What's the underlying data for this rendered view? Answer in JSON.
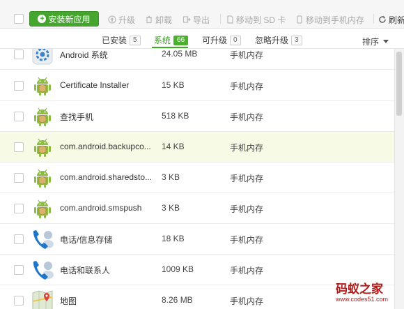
{
  "toolbar": {
    "install_label": "安装新应用",
    "items": [
      {
        "label": "升级",
        "icon": "upgrade-icon"
      },
      {
        "label": "卸载",
        "icon": "trash-icon"
      },
      {
        "label": "导出",
        "icon": "export-icon"
      },
      {
        "label": "移动到 SD 卡",
        "icon": "sd-card-icon"
      },
      {
        "label": "移动到手机内存",
        "icon": "phone-memory-icon"
      },
      {
        "label": "刷新",
        "icon": "refresh-icon"
      }
    ]
  },
  "tabs": [
    {
      "label": "已安装",
      "count": "5",
      "active": false
    },
    {
      "label": "系统",
      "count": "66",
      "active": true
    },
    {
      "label": "可升级",
      "count": "0",
      "active": false
    },
    {
      "label": "忽略升级",
      "count": "3",
      "active": false
    }
  ],
  "sort_label": "排序",
  "apps": [
    {
      "name": "Android 系统",
      "size": "24.05 MB",
      "location": "手机内存",
      "icon": "settings-gear-icon"
    },
    {
      "name": "Certificate Installer",
      "size": "15 KB",
      "location": "手机内存",
      "icon": "android-icon"
    },
    {
      "name": "查找手机",
      "size": "518 KB",
      "location": "手机内存",
      "icon": "android-icon"
    },
    {
      "name": "com.android.backupco...",
      "size": "14 KB",
      "location": "手机内存",
      "icon": "android-icon",
      "highlighted": true
    },
    {
      "name": "com.android.sharedsto...",
      "size": "3 KB",
      "location": "手机内存",
      "icon": "android-icon"
    },
    {
      "name": "com.android.smspush",
      "size": "3 KB",
      "location": "手机内存",
      "icon": "android-icon"
    },
    {
      "name": "电话/信息存储",
      "size": "18 KB",
      "location": "手机内存",
      "icon": "phone-contact-icon"
    },
    {
      "name": "电话和联系人",
      "size": "1009 KB",
      "location": "手机内存",
      "icon": "phone-contact-icon"
    },
    {
      "name": "地图",
      "size": "8.26 MB",
      "location": "手机内存",
      "icon": "map-icon"
    }
  ],
  "watermark": {
    "title": "码蚁之家",
    "url": "www.codes51.com"
  },
  "colors": {
    "accent": "#45a52e",
    "highlight_row": "#f7fbe6",
    "watermark": "#b21818"
  }
}
